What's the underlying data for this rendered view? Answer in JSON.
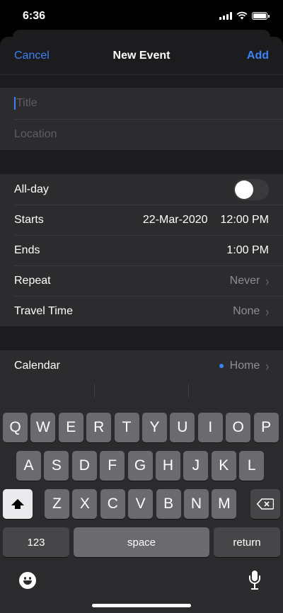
{
  "status_bar": {
    "time": "6:36"
  },
  "nav": {
    "cancel": "Cancel",
    "title": "New Event",
    "add": "Add"
  },
  "inputs": {
    "title_placeholder": "Title",
    "location_placeholder": "Location"
  },
  "rows": {
    "allday": {
      "label": "All-day",
      "on": false
    },
    "starts": {
      "label": "Starts",
      "date": "22-Mar-2020",
      "time": "12:00 PM"
    },
    "ends": {
      "label": "Ends",
      "time": "1:00 PM"
    },
    "repeat": {
      "label": "Repeat",
      "value": "Never"
    },
    "travel": {
      "label": "Travel Time",
      "value": "None"
    },
    "calendar": {
      "label": "Calendar",
      "value": "Home",
      "dot_color": "#3b82f6"
    }
  },
  "keyboard": {
    "row1": [
      "Q",
      "W",
      "E",
      "R",
      "T",
      "Y",
      "U",
      "I",
      "O",
      "P"
    ],
    "row2": [
      "A",
      "S",
      "D",
      "F",
      "G",
      "H",
      "J",
      "K",
      "L"
    ],
    "row3": [
      "Z",
      "X",
      "C",
      "V",
      "B",
      "N",
      "M"
    ],
    "numbers_label": "123",
    "space_label": "space",
    "return_label": "return"
  },
  "colors": {
    "accent": "#3b82f6",
    "sheet": "#1c1c1e",
    "cell": "#2c2c2e"
  }
}
